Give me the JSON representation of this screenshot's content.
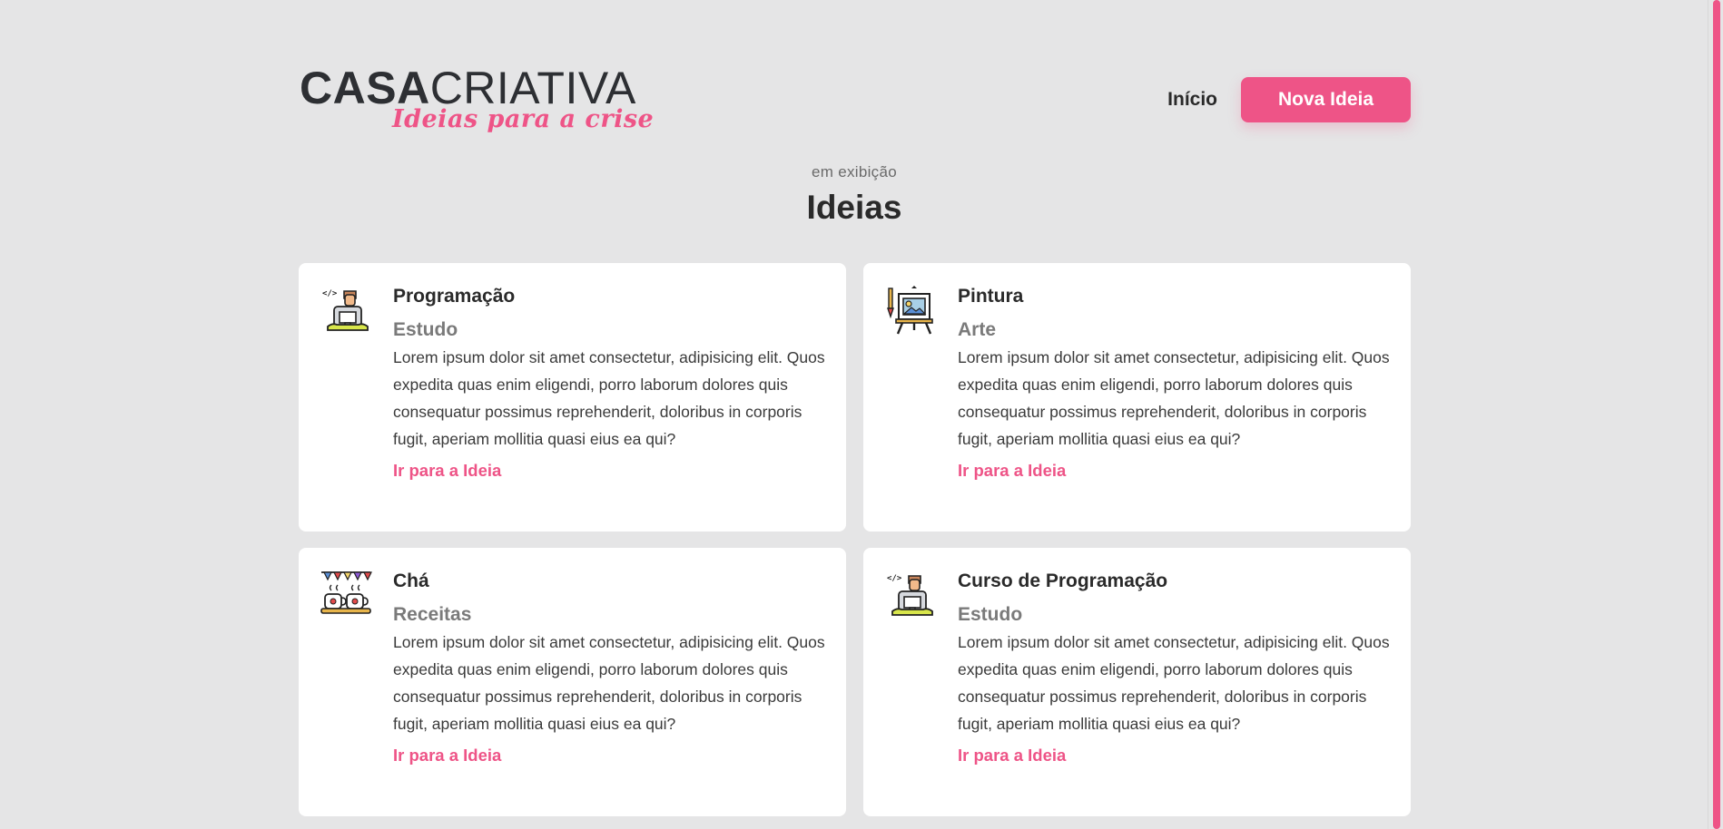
{
  "header": {
    "logo_main_bold": "CASA",
    "logo_main_light": "CRIATIVA",
    "logo_tagline": "Ideias para a crise",
    "nav_home": "Início",
    "nav_new_idea": "Nova Ideia"
  },
  "section": {
    "subtitle": "em exibição",
    "title": "Ideias"
  },
  "cards": [
    {
      "icon": "programmer-icon",
      "title": "Programação",
      "category": "Estudo",
      "description": "Lorem ipsum dolor sit amet consectetur, adipisicing elit. Quos expedita quas enim eligendi, porro laborum dolores quis consequatur possimus reprehenderit, doloribus in corporis fugit, aperiam mollitia quasi eius ea qui?",
      "link": "Ir para a Ideia"
    },
    {
      "icon": "painting-easel-icon",
      "title": "Pintura",
      "category": "Arte",
      "description": "Lorem ipsum dolor sit amet consectetur, adipisicing elit. Quos expedita quas enim eligendi, porro laborum dolores quis consequatur possimus reprehenderit, doloribus in corporis fugit, aperiam mollitia quasi eius ea qui?",
      "link": "Ir para a Ideia"
    },
    {
      "icon": "tea-cups-icon",
      "title": "Chá",
      "category": "Receitas",
      "description": "Lorem ipsum dolor sit amet consectetur, adipisicing elit. Quos expedita quas enim eligendi, porro laborum dolores quis consequatur possimus reprehenderit, doloribus in corporis fugit, aperiam mollitia quasi eius ea qui?",
      "link": "Ir para a Ideia"
    },
    {
      "icon": "programmer-icon",
      "title": "Curso de Programação",
      "category": "Estudo",
      "description": "Lorem ipsum dolor sit amet consectetur, adipisicing elit. Quos expedita quas enim eligendi, porro laborum dolores quis consequatur possimus reprehenderit, doloribus in corporis fugit, aperiam mollitia quasi eius ea qui?",
      "link": "Ir para a Ideia"
    }
  ],
  "colors": {
    "accent": "#ee5487",
    "background": "#e5e5e6",
    "card": "#ffffff",
    "text": "#2a2a2a",
    "muted": "#7a7a7a"
  }
}
